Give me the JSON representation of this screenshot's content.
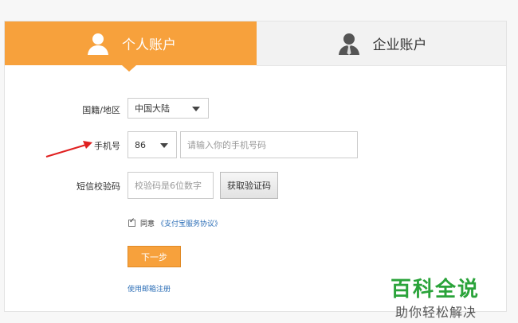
{
  "tabs": {
    "personal": "个人账户",
    "business": "企业账户"
  },
  "form": {
    "country_label": "国籍/地区",
    "country_value": "中国大陆",
    "phone_label": "手机号",
    "phone_code": "86",
    "phone_placeholder": "请输入你的手机号码",
    "sms_label": "短信校验码",
    "sms_placeholder": "校验码是6位数字",
    "get_code_button": "获取验证码",
    "agree_text": "同意",
    "agreement_link": "《支付宝服务协议》",
    "next_button": "下一步",
    "email_register_link": "使用邮箱注册"
  },
  "watermark": {
    "title": "百科全说",
    "subtitle": "助你轻松解决"
  },
  "colors": {
    "accent": "#f7a13c",
    "link": "#2d6fb7",
    "arrow": "#e02020",
    "watermark": "#2aa33a"
  }
}
